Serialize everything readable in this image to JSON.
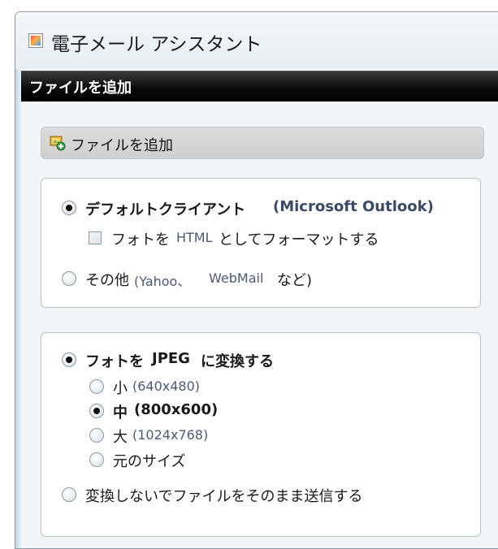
{
  "window": {
    "title": "電子メール アシスタント"
  },
  "header": {
    "title": "ファイルを追加"
  },
  "add_file_button": {
    "label": "ファイルを追加"
  },
  "email_client": {
    "default_client_label": "デフォルトクライアント",
    "default_client_name": "(Microsoft Outlook)",
    "default_client_checked": true,
    "format_html_checkbox": {
      "label_prefix": "フォトを",
      "label_html": "HTML",
      "label_suffix": "としてフォーマットする",
      "checked": false
    },
    "other_label": "その他",
    "other_detail_1": "(Yahoo、",
    "other_detail_2": "WebMail",
    "other_detail_3": "など)",
    "other_checked": false
  },
  "conversion": {
    "convert_label_prefix": "フォトを",
    "convert_label_jpeg": "JPEG",
    "convert_label_suffix": "に変換する",
    "convert_checked": true,
    "sizes": [
      {
        "label": "小",
        "detail": "(640x480)",
        "checked": false,
        "bold": false
      },
      {
        "label": "中",
        "detail": "(800x600)",
        "checked": true,
        "bold": true
      },
      {
        "label": "大",
        "detail": "(1024x768)",
        "checked": false,
        "bold": false
      },
      {
        "label": "元のサイズ",
        "detail": "",
        "checked": false,
        "bold": false
      }
    ],
    "no_convert_label": "変換しないでファイルをそのまま送信する",
    "no_convert_checked": false
  }
}
